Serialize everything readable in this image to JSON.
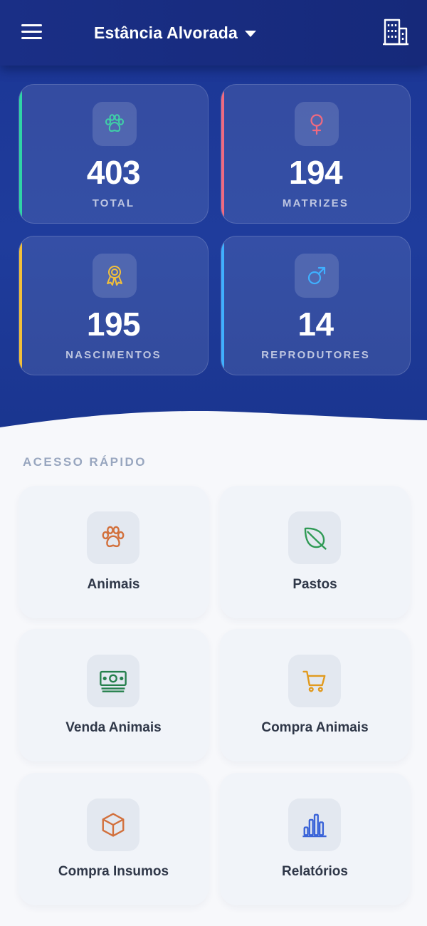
{
  "header": {
    "farm_name": "Estância Alvorada",
    "menu_icon": "hamburger-menu-icon",
    "farm_icon": "building-icon"
  },
  "stats": [
    {
      "label": "TOTAL",
      "value": "403",
      "icon": "paw-icon",
      "accent": "#2fd4a6",
      "icon_color": "#3fd1a7"
    },
    {
      "label": "MATRIZES",
      "value": "194",
      "icon": "female-symbol-icon",
      "accent": "#f06a80",
      "icon_color": "#f06a80"
    },
    {
      "label": "NASCIMENTOS",
      "value": "195",
      "icon": "award-ribbon-icon",
      "accent": "#f2c03a",
      "icon_color": "#f2c03a"
    },
    {
      "label": "REPRODUTORES",
      "value": "14",
      "icon": "male-symbol-icon",
      "accent": "#3fb0ff",
      "icon_color": "#3fb0ff"
    }
  ],
  "quick_access": {
    "title": "ACESSO RÁPIDO",
    "items": [
      {
        "label": "Animais",
        "icon": "paw-icon",
        "icon_color": "#d2703c"
      },
      {
        "label": "Pastos",
        "icon": "leaf-icon",
        "icon_color": "#2f9a55"
      },
      {
        "label": "Venda Animais",
        "icon": "money-icon",
        "icon_color": "#25804c"
      },
      {
        "label": "Compra Animais",
        "icon": "shopping-cart-icon",
        "icon_color": "#e19a1e"
      },
      {
        "label": "Compra Insumos",
        "icon": "box-icon",
        "icon_color": "#d2703c"
      },
      {
        "label": "Relatórios",
        "icon": "bar-chart-icon",
        "icon_color": "#3a63d8"
      }
    ]
  }
}
